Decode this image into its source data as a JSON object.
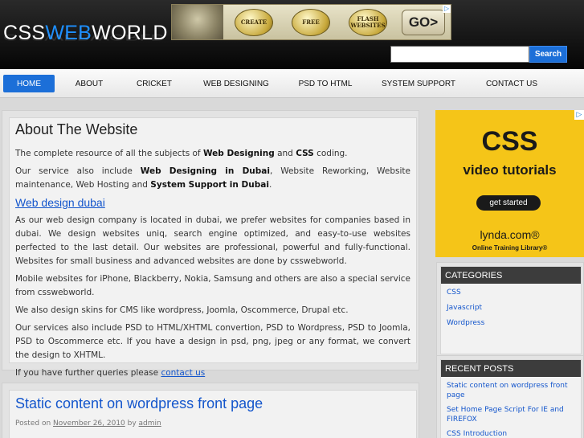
{
  "header": {
    "logo_part1": "CSS",
    "logo_part2": "WEB",
    "logo_part3": "WORLD",
    "banner": {
      "badge1": "CREATE",
      "badge2": "FREE",
      "badge3": "FLASH WEBSITES",
      "go": "GO>",
      "ad_icon": "▷"
    },
    "search_placeholder": "",
    "search_button": "Search"
  },
  "nav": {
    "items": [
      {
        "label": "HOME"
      },
      {
        "label": "ABOUT"
      },
      {
        "label": "CRICKET"
      },
      {
        "label": "WEB DESIGNING"
      },
      {
        "label": "PSD TO HTML"
      },
      {
        "label": "SYSTEM SUPPORT"
      },
      {
        "label": "CONTACT US"
      }
    ],
    "active_index": 0
  },
  "about": {
    "title": "About The Website",
    "p1_a": "The complete resource of all the subjects of ",
    "p1_b": "Web Designing",
    "p1_c": " and ",
    "p1_d": "CSS",
    "p1_e": " coding.",
    "p2_a": "Our service also include ",
    "p2_b": "Web Designing in Dubai",
    "p2_c": ", Website Reworking, Website maintenance, Web Hosting and ",
    "p2_d": "System Support in Dubai",
    "p2_e": ".",
    "subheading": "Web design dubai",
    "p3": "As our web design company is located in dubai, we prefer websites for companies based in dubai. We design websites uniq, search engine optimized, and easy-to-use websites perfected to the last detail. Our websites are professional, powerful and fully-functional. Websites for small business and advanced websites are done by csswebworld.",
    "p4": "Mobile websites for iPhone, Blackberry, Nokia, Samsung and others are also a special service from csswebworld.",
    "p5": "We also design skins for CMS like wordpress, Joomla, Oscommerce, Drupal etc.",
    "p6": "Our services also include PSD to HTML/XHTML convertion, PSD to Wordpress, PSD to Joomla, PSD to Oscommerce etc. If you have a design in psd, png, jpeg or any format, we convert the design to XHTML.",
    "p7_a": "If you have further queries please ",
    "p7_link": "contact us"
  },
  "post": {
    "title": "Static content on wordpress front page",
    "meta_posted": "Posted on ",
    "date": "November 26, 2010",
    "meta_by": " by ",
    "author": "admin"
  },
  "ad_sidebar": {
    "headline": "CSS",
    "subline": "video tutorials",
    "button": "get started",
    "brand": "lynda.com®",
    "tagline": "Online Training Library®",
    "ad_icon": "▷"
  },
  "categories": {
    "title": "CATEGORIES",
    "items": [
      "CSS",
      "Javascript",
      "Wordpress"
    ]
  },
  "recent_posts": {
    "title": "RECENT POSTS",
    "items": [
      "Static content on wordpress front page",
      "Set Home Page Script For IE and FIREFOX",
      "CSS Introduction"
    ]
  },
  "colors": {
    "accent": "#1c6fd8",
    "link": "#1456cc",
    "header_bg": "#0a0a0a",
    "ad_yellow": "#f5c518"
  }
}
